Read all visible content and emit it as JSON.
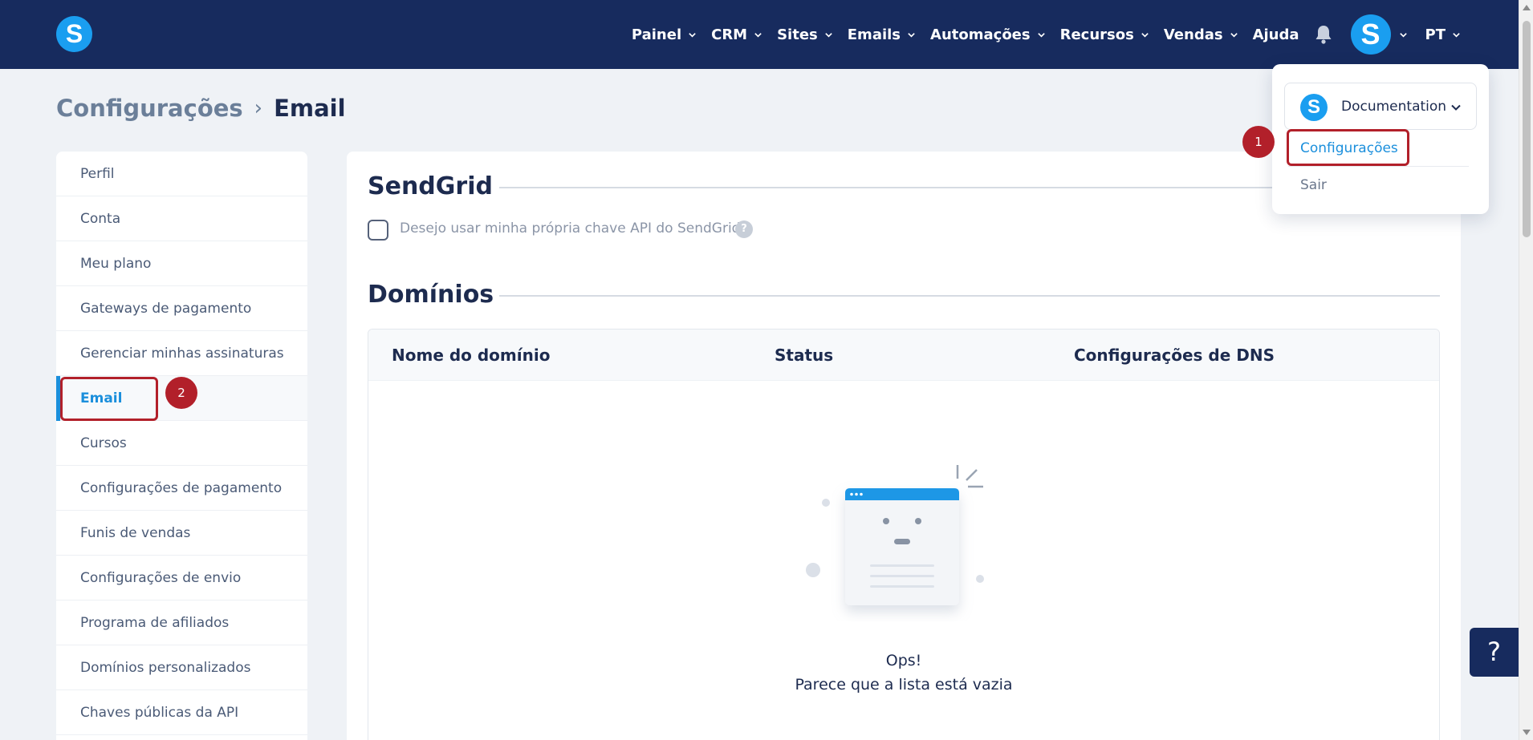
{
  "brand": {
    "logo_letter": "S",
    "color": "#1a9ef0",
    "navbar_color": "#172b5e"
  },
  "nav": {
    "items": [
      {
        "label": "Painel",
        "has_dropdown": true
      },
      {
        "label": "CRM",
        "has_dropdown": true
      },
      {
        "label": "Sites",
        "has_dropdown": true
      },
      {
        "label": "Emails",
        "has_dropdown": true
      },
      {
        "label": "Automações",
        "has_dropdown": true
      },
      {
        "label": "Recursos",
        "has_dropdown": true
      },
      {
        "label": "Vendas",
        "has_dropdown": true
      },
      {
        "label": "Ajuda",
        "has_dropdown": false
      }
    ],
    "bell_icon": "bell-icon",
    "avatar_letter": "S",
    "language": "PT"
  },
  "breadcrumb": {
    "parent": "Configurações",
    "separator": "›",
    "current": "Email"
  },
  "sidebar": {
    "items": [
      {
        "label": "Perfil",
        "active": false
      },
      {
        "label": "Conta",
        "active": false
      },
      {
        "label": "Meu plano",
        "active": false
      },
      {
        "label": "Gateways de pagamento",
        "active": false
      },
      {
        "label": "Gerenciar minhas assinaturas",
        "active": false
      },
      {
        "label": "Email",
        "active": true
      },
      {
        "label": "Cursos",
        "active": false
      },
      {
        "label": "Configurações de pagamento",
        "active": false
      },
      {
        "label": "Funis de vendas",
        "active": false
      },
      {
        "label": "Configurações de envio",
        "active": false
      },
      {
        "label": "Programa de afiliados",
        "active": false
      },
      {
        "label": "Domínios personalizados",
        "active": false
      },
      {
        "label": "Chaves públicas da API",
        "active": false
      }
    ]
  },
  "sendgrid": {
    "title": "SendGrid",
    "checkbox_label": "Desejo usar minha própria chave API do SendGrid",
    "checkbox_checked": false,
    "help_glyph": "?"
  },
  "domains": {
    "title": "Domínios",
    "columns": [
      "Nome do domínio",
      "Status",
      "Configurações de DNS"
    ],
    "rows": [],
    "empty_title": "Ops!",
    "empty_subtitle": "Parece que a lista está vazia"
  },
  "dropdown": {
    "account_name": "Documentation",
    "account_logo_letter": "S",
    "config_label": "Configurações",
    "exit_label": "Sair"
  },
  "annotations": {
    "badge_1": "1",
    "badge_2": "2",
    "color": "#b2202a"
  },
  "help_fab": {
    "glyph": "?"
  }
}
